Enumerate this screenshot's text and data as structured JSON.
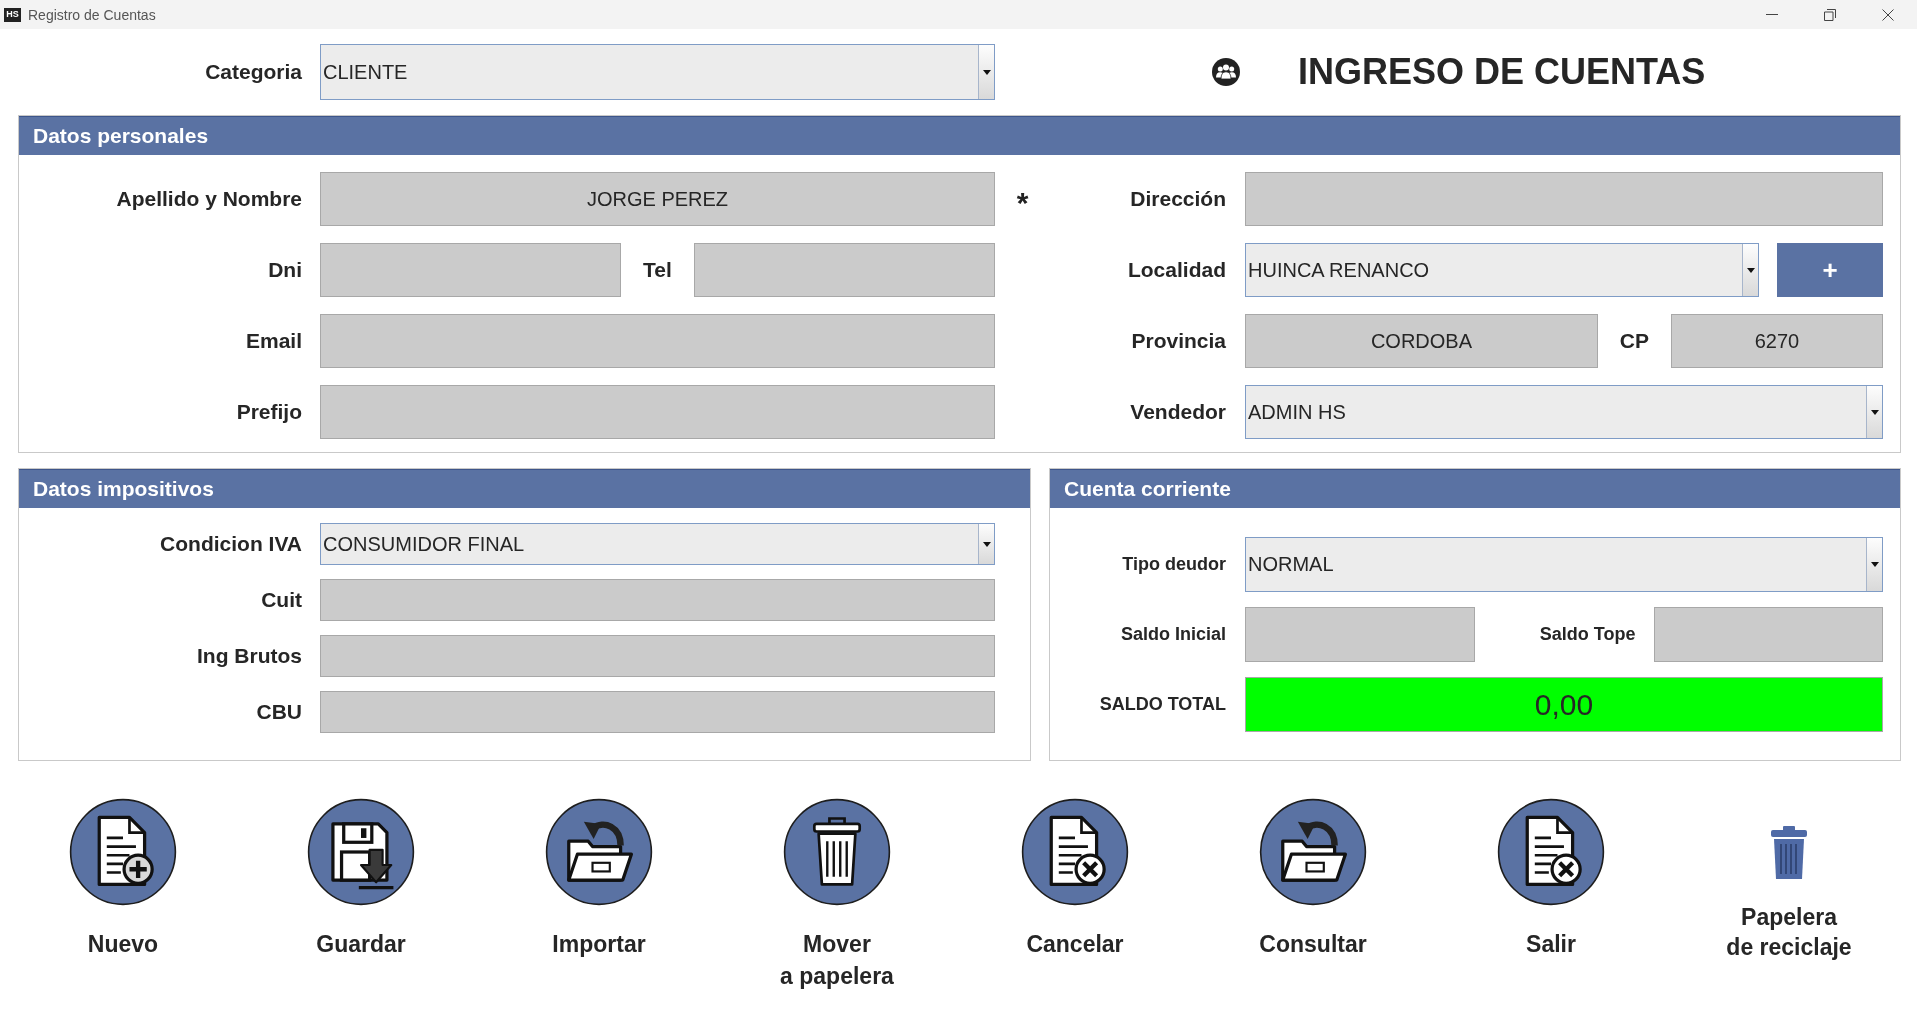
{
  "window": {
    "app_icon": "HS",
    "title": "Registro de Cuentas"
  },
  "header": {
    "category": {
      "label": "Categoria",
      "control": {
        "kind": "combo",
        "value": "CLIENTE"
      }
    },
    "title": "INGRESO DE CUENTAS"
  },
  "personal_data": {
    "title": "Datos personales",
    "rows": [
      {
        "left": {
          "label": "Apellido y Nombre",
          "required_mark": "*",
          "controls": [
            {
              "kind": "text",
              "value": "JORGE PEREZ"
            }
          ]
        },
        "right": {
          "label": "Dirección",
          "controls": [
            {
              "kind": "text"
            }
          ]
        }
      },
      {
        "left": {
          "label": "Dni",
          "controls": [
            {
              "kind": "text"
            },
            {
              "kind": "label",
              "text": "Tel"
            },
            {
              "kind": "text"
            }
          ]
        },
        "right": {
          "label": "Localidad",
          "controls": [
            {
              "kind": "combo",
              "value": "HUINCA RENANCO"
            },
            {
              "kind": "button",
              "label": "+"
            }
          ]
        }
      },
      {
        "left": {
          "label": "Email",
          "controls": [
            {
              "kind": "text"
            }
          ]
        },
        "right": {
          "label": "Provincia",
          "controls": [
            {
              "kind": "text",
              "value": "CORDOBA"
            },
            {
              "kind": "label",
              "text": "CP"
            },
            {
              "kind": "text",
              "value": "6270"
            }
          ]
        }
      },
      {
        "left": {
          "label": "Prefijo",
          "controls": [
            {
              "kind": "text"
            }
          ]
        },
        "right": {
          "label": "Vendedor",
          "controls": [
            {
              "kind": "combo",
              "value": "ADMIN HS"
            }
          ]
        }
      }
    ]
  },
  "tax_data": {
    "title": "Datos impositivos",
    "rows": [
      {
        "label": "Condicion IVA",
        "controls": [
          {
            "kind": "combo",
            "value": "CONSUMIDOR FINAL"
          }
        ]
      },
      {
        "label": "Cuit",
        "controls": [
          {
            "kind": "text"
          }
        ]
      },
      {
        "label": "Ing Brutos",
        "controls": [
          {
            "kind": "text"
          }
        ]
      },
      {
        "label": "CBU",
        "controls": [
          {
            "kind": "text"
          }
        ]
      }
    ]
  },
  "current_account": {
    "title": "Cuenta corriente",
    "rows": [
      {
        "label": "Tipo deudor",
        "controls": [
          {
            "kind": "combo",
            "value": "NORMAL"
          }
        ]
      },
      {
        "label": "Saldo Inicial",
        "controls": [
          {
            "kind": "text"
          },
          {
            "kind": "label",
            "text": "Saldo Tope"
          },
          {
            "kind": "text"
          }
        ]
      },
      {
        "label": "SALDO TOTAL",
        "controls": [
          {
            "kind": "total",
            "value": "0,00",
            "color": "#00ff00"
          }
        ]
      }
    ]
  },
  "actions": [
    {
      "kind": "new",
      "label": "Nuevo"
    },
    {
      "kind": "save",
      "label": "Guardar"
    },
    {
      "kind": "import",
      "label": "Importar"
    },
    {
      "kind": "trash",
      "label": "Mover\na papelera"
    },
    {
      "kind": "cancel",
      "label": "Cancelar"
    },
    {
      "kind": "consult",
      "label": "Consultar"
    },
    {
      "kind": "exit",
      "label": "Salir"
    },
    {
      "kind": "recycle",
      "label": "Papelera\nde reciclaje"
    }
  ]
}
